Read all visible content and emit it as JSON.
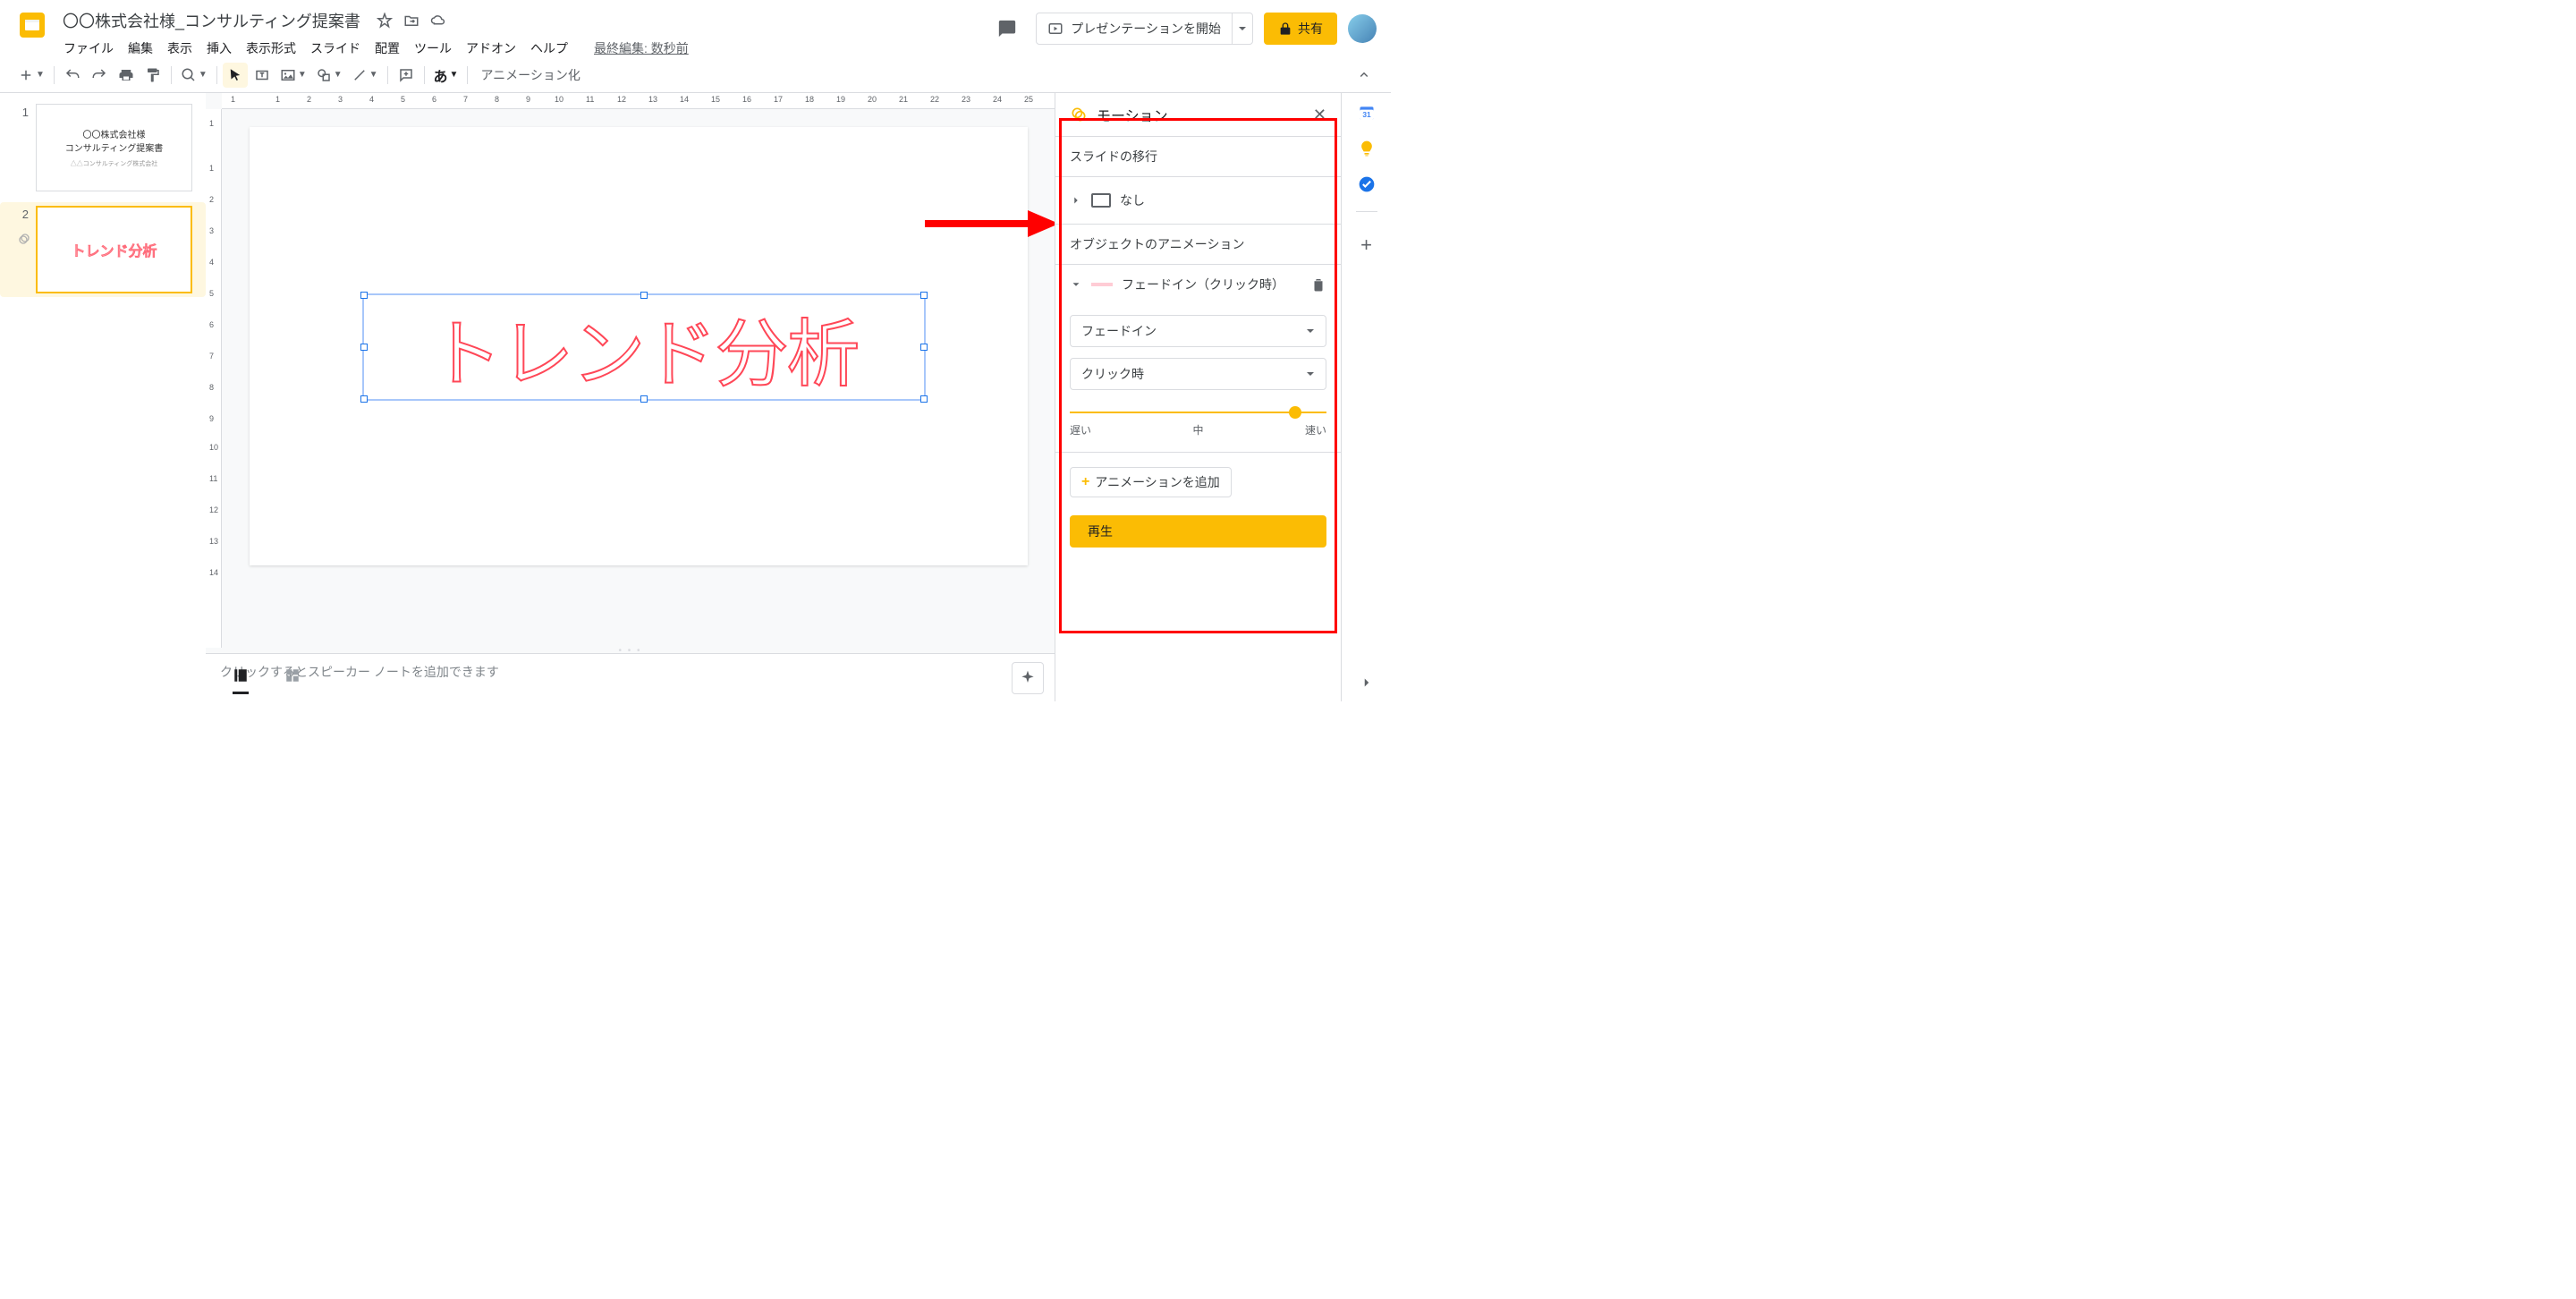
{
  "doc": {
    "title": "〇〇株式会社様_コンサルティング提案書",
    "last_edit": "最終編集: 数秒前"
  },
  "menu": {
    "file": "ファイル",
    "edit": "編集",
    "view": "表示",
    "insert": "挿入",
    "format": "表示形式",
    "slide": "スライド",
    "arrange": "配置",
    "tools": "ツール",
    "addons": "アドオン",
    "help": "ヘルプ"
  },
  "header": {
    "present": "プレゼンテーションを開始",
    "share": "共有"
  },
  "toolbar": {
    "animate": "アニメーション化",
    "text_tool": "あ"
  },
  "thumbs": {
    "s1": {
      "num": "1",
      "line1": "〇〇株式会社様",
      "line2": "コンサルティング提案書",
      "sub": "△△コンサルティング株式会社"
    },
    "s2": {
      "num": "2",
      "text": "トレンド分析"
    }
  },
  "canvas": {
    "main_text": "トレンド分析"
  },
  "ruler_h": [
    "1",
    "",
    "1",
    "2",
    "3",
    "4",
    "5",
    "6",
    "7",
    "8",
    "9",
    "10",
    "11",
    "12",
    "13",
    "14",
    "15",
    "16",
    "17",
    "18",
    "19",
    "20",
    "21",
    "22",
    "23",
    "24",
    "25"
  ],
  "ruler_v": [
    "1",
    "",
    "1",
    "2",
    "3",
    "4",
    "5",
    "6",
    "7",
    "8",
    "9",
    "10",
    "11",
    "12",
    "13",
    "14"
  ],
  "notes": {
    "placeholder": "クリックするとスピーカー ノートを追加できます"
  },
  "motion": {
    "title": "モーション",
    "section_transition": "スライドの移行",
    "transition_none": "なし",
    "section_object": "オブジェクトのアニメーション",
    "anim_label": "フェードイン（クリック時）",
    "type_select": "フェードイン",
    "start_select": "クリック時",
    "speed_slow": "遅い",
    "speed_mid": "中",
    "speed_fast": "速い",
    "add_anim": "アニメーションを追加",
    "play": "再生"
  }
}
